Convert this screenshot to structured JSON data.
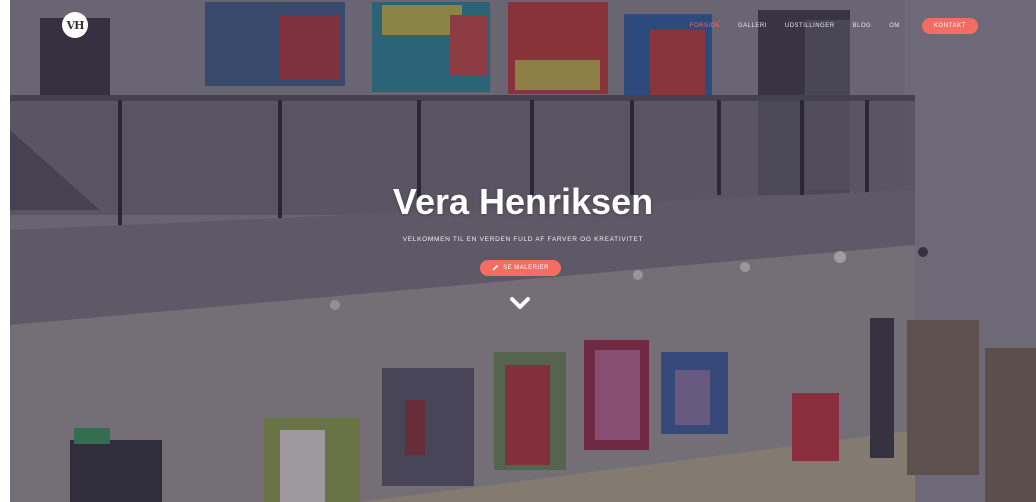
{
  "logo": {
    "text": "VH"
  },
  "nav": {
    "links": [
      "FORSIDE",
      "GALLERI",
      "UDSTILLINGER",
      "BLOG",
      "OM"
    ],
    "active_index": 0,
    "cta_label": "KONTAKT"
  },
  "hero": {
    "title": "Vera Henriksen",
    "subtitle": "VELKOMMEN TIL EN VERDEN FULD AF FARVER OG KREATIVITET",
    "button_label": "SE MALERIER",
    "button_icon": "pencil-icon",
    "scroll_icon": "chevron-down-icon"
  },
  "colors": {
    "accent": "#f46d63",
    "overlay": "#2c2640"
  }
}
